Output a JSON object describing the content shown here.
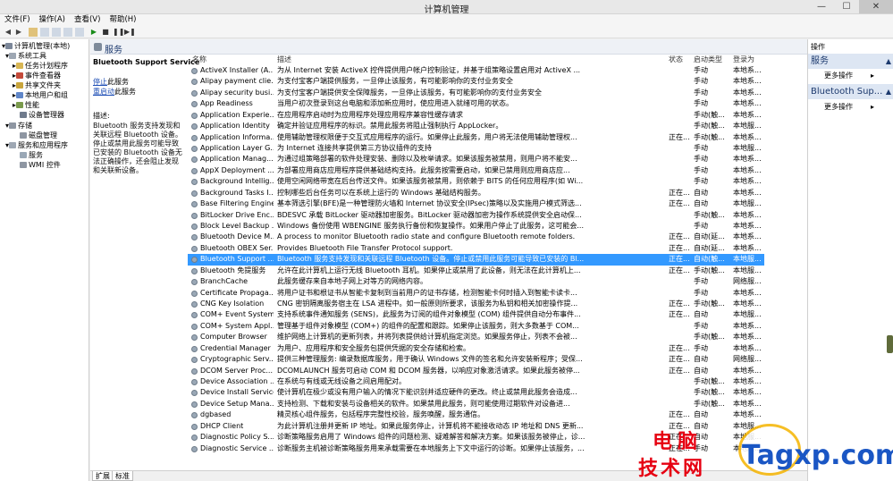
{
  "window": {
    "title": "计算机管理",
    "min": "—",
    "max": "☐",
    "close": "✕"
  },
  "menu": [
    "文件(F)",
    "操作(A)",
    "查看(V)",
    "帮助(H)"
  ],
  "tree": [
    {
      "label": "计算机管理(本地)",
      "level": 0,
      "expander": "▾"
    },
    {
      "label": "系统工具",
      "level": 1,
      "expander": "▾"
    },
    {
      "label": "任务计划程序",
      "level": 2,
      "expander": "▸"
    },
    {
      "label": "事件查看器",
      "level": 2,
      "expander": "▸"
    },
    {
      "label": "共享文件夹",
      "level": 2,
      "expander": "▸"
    },
    {
      "label": "本地用户和组",
      "level": 2,
      "expander": "▸"
    },
    {
      "label": "性能",
      "level": 2,
      "expander": "▸"
    },
    {
      "label": "设备管理器",
      "level": 2,
      "expander": ""
    },
    {
      "label": "存储",
      "level": 1,
      "expander": "▾"
    },
    {
      "label": "磁盘管理",
      "level": 2,
      "expander": ""
    },
    {
      "label": "服务和应用程序",
      "level": 1,
      "expander": "▾"
    },
    {
      "label": "服务",
      "level": 2,
      "expander": ""
    },
    {
      "label": "WMI 控件",
      "level": 2,
      "expander": ""
    }
  ],
  "center": {
    "title": "服务",
    "desc": {
      "service_name": "Bluetooth Support Service",
      "stop_link": "停止",
      "stop_suffix": "此服务",
      "restart_link": "重启动",
      "restart_suffix": "此服务",
      "desc_label": "描述:",
      "desc_text": "Bluetooth 服务支持发现和关联远程 Bluetooth 设备。停止或禁用此服务可能导致已安装的 Bluetooth 设备无法正确操作，还会阻止发现和关联新设备。"
    },
    "columns": [
      "名称",
      "描述",
      "状态",
      "启动类型",
      "登录为"
    ],
    "rows": [
      [
        "ActiveX Installer (A...",
        "为从 Internet 安装 ActiveX 控件提供用户帐户控制验证，并基于组策略设置启用对 ActiveX ...",
        "",
        "手动",
        "本地系..."
      ],
      [
        "Alipay payment clie...",
        "为支付宝客户端提供服务，一旦停止该服务，有可能影响你的支付业务安全",
        "",
        "手动",
        "本地系..."
      ],
      [
        "Alipay security busi...",
        "为支付宝客户端提供安全保障服务，一旦停止该服务，有可能影响你的支付业务安全",
        "",
        "手动",
        "本地系..."
      ],
      [
        "App Readiness",
        "当用户初次登录到这台电脑和添加新应用时，使应用进入就绪可用的状态。",
        "",
        "手动",
        "本地系..."
      ],
      [
        "Application Experie...",
        "在应用程序启动时为应用程序处理应用程序兼容性缓存请求",
        "",
        "手动(触...",
        "本地系..."
      ],
      [
        "Application Identity",
        "确定并验证应用程序的标识。禁用此服务将阻止强制执行 AppLocker。",
        "",
        "手动(触...",
        "本地服..."
      ],
      [
        "Application Informa...",
        "使用辅助管理权限便于交互式应用程序的运行。如果停止此服务，用户将无法使用辅助管理权...",
        "正在...",
        "手动(触...",
        "本地系..."
      ],
      [
        "Application Layer G...",
        "为 Internet 连接共享提供第三方协议插件的支持",
        "",
        "手动",
        "本地服..."
      ],
      [
        "Application Manag...",
        "为通过组策略部署的软件处理安装、删除以及枚举请求。如果该服务被禁用，则用户将不能安...",
        "",
        "手动",
        "本地系..."
      ],
      [
        "AppX Deployment ...",
        "为部署应用商店应用程序提供基础结构支持。此服务按需要启动，如果已禁用则应用商店应...",
        "",
        "手动",
        "本地系..."
      ],
      [
        "Background Intellig...",
        "使用空闲网络带宽在后台传送文件。如果该服务被禁用，则依赖于 BITS 的任何应用程序(如 Wi...",
        "",
        "手动",
        "本地系..."
      ],
      [
        "Background Tasks I...",
        "控制哪些后台任务可以在系统上运行的 Windows 基础结构服务。",
        "正在...",
        "自动",
        "本地系..."
      ],
      [
        "Base Filtering Engine",
        "基本筛选引擎(BFE)是一种管理防火墙和 Internet 协议安全(IPsec)策略以及实施用户模式筛选...",
        "正在...",
        "自动",
        "本地服..."
      ],
      [
        "BitLocker Drive Enc...",
        "BDESVC 承载 BitLocker 驱动器加密服务。BitLocker 驱动器加密为操作系统提供安全启动保...",
        "",
        "手动(触...",
        "本地系..."
      ],
      [
        "Block Level Backup ...",
        "Windows 备份使用 WBENGINE 服务执行备份和恢复操作。如果用户停止了此服务，这可能会...",
        "",
        "手动",
        "本地系..."
      ],
      [
        "Bluetooth Device M...",
        "A process to monitor Bluetooth radio state and configure Bluetooth remote folders.",
        "正在...",
        "自动(延...",
        "本地系..."
      ],
      [
        "Bluetooth OBEX Ser...",
        "Provides Bluetooth File Transfer Protocol support.",
        "正在...",
        "自动(延...",
        "本地系..."
      ],
      [
        "Bluetooth Support ...",
        "Bluetooth 服务支持发现和关联远程 Bluetooth 设备。停止或禁用此服务可能导致已安装的 Bl...",
        "正在...",
        "自动(触...",
        "本地服..."
      ],
      [
        "Bluetooth 免提服务",
        "允许在此计算机上运行无线 Bluetooth 耳机。如果停止或禁用了此设备，则无法在此计算机上...",
        "正在...",
        "手动(触...",
        "本地服..."
      ],
      [
        "BranchCache",
        "此服务缓存来自本地子网上对等方的网络内容。",
        "",
        "手动",
        "网络服..."
      ],
      [
        "Certificate Propaga...",
        "将用户证书和根证书从智能卡复制到当前用户的证书存储，检测智能卡何时插入到智能卡读卡...",
        "",
        "手动",
        "本地系..."
      ],
      [
        "CNG Key Isolation",
        "CNG 密钥隔离服务宿主在 LSA 进程中。如一般原则所要求，该服务为私钥和相关加密操作提...",
        "正在...",
        "手动(触...",
        "本地系..."
      ],
      [
        "COM+ Event System",
        "支持系统事件通知服务 (SENS)，此服务为订阅的组件对象模型 (COM) 组件提供自动分布事件...",
        "正在...",
        "自动",
        "本地服..."
      ],
      [
        "COM+ System Appl...",
        "管理基于组件对象模型 (COM+) 的组件的配置和跟踪。如果停止该服务，则大多数基于 COM...",
        "",
        "手动",
        "本地系..."
      ],
      [
        "Computer Browser",
        "维护网络上计算机的更新列表，并将列表提供给计算机指定浏览。如果服务停止，列表不会被...",
        "",
        "手动(触...",
        "本地系..."
      ],
      [
        "Credential Manager",
        "为用户、应用程序和安全服务包提供凭据的安全存储和检索。",
        "正在...",
        "手动",
        "本地系..."
      ],
      [
        "Cryptographic Serv...",
        "提供三种管理服务: 编录数据库服务，用于确认 Windows 文件的签名和允许安装新程序；受保...",
        "正在...",
        "自动",
        "网络服..."
      ],
      [
        "DCOM Server Proc...",
        "DCOMLAUNCH 服务可启动 COM 和 DCOM 服务器，以响应对象激活请求。如果此服务被停...",
        "正在...",
        "自动",
        "本地系..."
      ],
      [
        "Device Association ...",
        "在系统与有线或无线设备之间启用配对。",
        "",
        "手动(触...",
        "本地系..."
      ],
      [
        "Device Install Service",
        "使计算机在极少或没有用户输入的情况下能识别并适应硬件的更改。终止或禁用此服务会造成...",
        "",
        "手动(触...",
        "本地系..."
      ],
      [
        "Device Setup Mana...",
        "支持检测、下载和安装与设备相关的软件。如果禁用此服务，则可能使用过期软件对设备进...",
        "",
        "手动(触...",
        "本地系..."
      ],
      [
        "dgbased",
        "精灵核心组件服务，包括程序完整性校验，服务唤醒，服务通信。",
        "正在...",
        "自动",
        "本地系..."
      ],
      [
        "DHCP Client",
        "为此计算机注册并更新 IP 地址。如果此服务停止，计算机将不能接收动态 IP 地址和 DNS 更新...",
        "正在...",
        "自动",
        "本地服..."
      ],
      [
        "Diagnostic Policy S...",
        "诊断策略服务启用了 Windows 组件的问题检测、疑难解答和解决方案。如果该服务被停止，诊...",
        "正在...",
        "自动",
        "本地服..."
      ],
      [
        "Diagnostic Service ...",
        "诊断服务主机被诊断策略服务用来承载需要在本地服务上下文中运行的诊断。如果停止该服务，...",
        "正在...",
        "手动",
        "本地服..."
      ]
    ],
    "selected_index": 17,
    "tabs": [
      "扩展",
      "标准"
    ]
  },
  "actions": {
    "header": "操作",
    "sections": [
      {
        "title": "服务",
        "more": "更多操作"
      },
      {
        "title": "Bluetooth Sup...",
        "more": "更多操作"
      }
    ]
  },
  "watermark": {
    "cn_line1": "电脑",
    "cn_line2": "技术网",
    "site": "Tagxp.com"
  }
}
